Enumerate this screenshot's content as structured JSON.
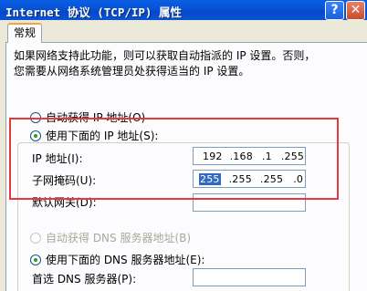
{
  "window": {
    "title": "Internet 协议 (TCP/IP) 属性",
    "help_glyph": "?",
    "close_glyph": "✕"
  },
  "tabs": [
    {
      "label": "常规"
    }
  ],
  "description": {
    "line1": "如果网络支持此功能，则可以获取自动指派的 IP 设置。否则，",
    "line2": "您需要从网络系统管理员处获得适当的 IP 设置。"
  },
  "ip_auto": {
    "label": "自动获得 IP 地址(O)",
    "selected": false
  },
  "ip_manual": {
    "label": "使用下面的 IP 地址(S):",
    "selected": true
  },
  "ip_fields": {
    "ip_label": "IP 地址(I):",
    "ip_value": [
      "192",
      ".168",
      ".1",
      ".255"
    ],
    "mask_label": "子网掩码(U):",
    "mask_value": [
      "255",
      ".255",
      ".255",
      ".0"
    ],
    "gateway_label": "默认网关(D):",
    "gateway_value": ""
  },
  "dns_auto": {
    "label": "自动获得 DNS 服务器地址(B)",
    "selected": false,
    "disabled": true
  },
  "dns_manual": {
    "label": "使用下面的 DNS 服务器地址(E):",
    "selected": true
  },
  "dns_fields": {
    "preferred_label": "首选 DNS 服务器(P):",
    "preferred_value": ""
  },
  "colors": {
    "highlight_box": "#e8373d",
    "selection": "#316ac5"
  }
}
